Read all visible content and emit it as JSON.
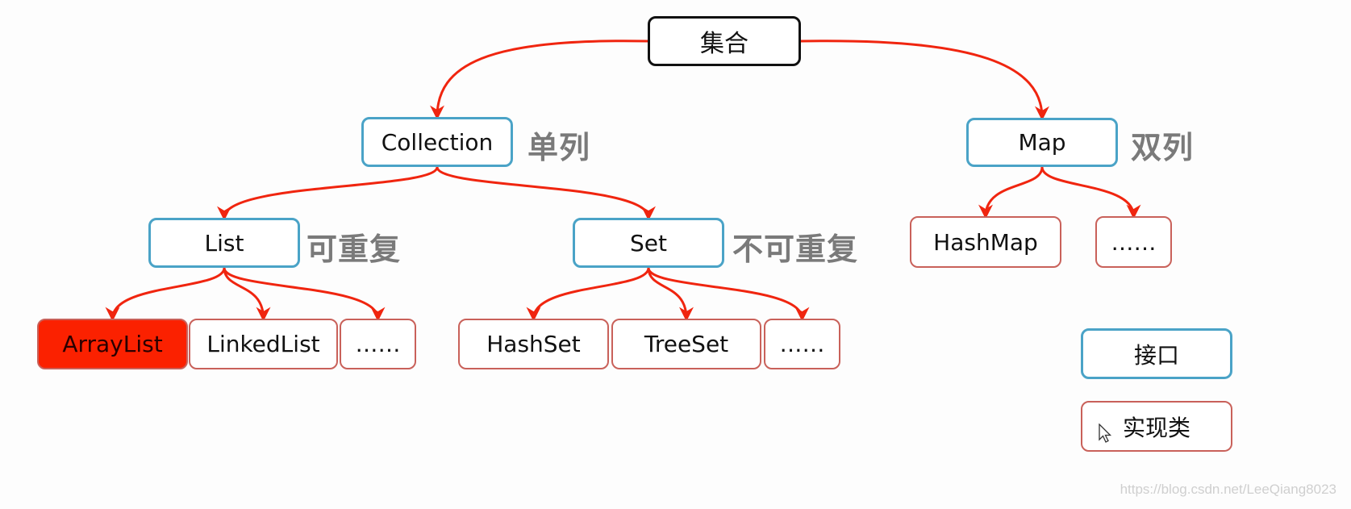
{
  "diagram": {
    "colors": {
      "edge": "#f0250f",
      "interface_border": "#4aa3c7",
      "impl_border": "#c9615a",
      "root_border": "#111111",
      "highlight_fill": "#fb2100",
      "note_text": "#7a7a7a"
    },
    "nodes": {
      "root": "集合",
      "collection": "Collection",
      "map": "Map",
      "list": "List",
      "set": "Set",
      "hashmap": "HashMap",
      "map_more": "……",
      "arraylist": "ArrayList",
      "linkedlist": "LinkedList",
      "list_more": "……",
      "hashset": "HashSet",
      "treeset": "TreeSet",
      "set_more": "……"
    },
    "notes": {
      "collection": "单列",
      "map": "双列",
      "list": "可重复",
      "set": "不可重复"
    },
    "edges": [
      [
        "root",
        "collection"
      ],
      [
        "root",
        "map"
      ],
      [
        "collection",
        "list"
      ],
      [
        "collection",
        "set"
      ],
      [
        "map",
        "hashmap"
      ],
      [
        "map",
        "map_more"
      ],
      [
        "list",
        "arraylist"
      ],
      [
        "list",
        "linkedlist"
      ],
      [
        "list",
        "list_more"
      ],
      [
        "set",
        "hashset"
      ],
      [
        "set",
        "treeset"
      ],
      [
        "set",
        "set_more"
      ]
    ],
    "legend": {
      "interface": "接口",
      "implementation": "实现类"
    },
    "watermark": "https://blog.csdn.net/LeeQiang8023"
  }
}
